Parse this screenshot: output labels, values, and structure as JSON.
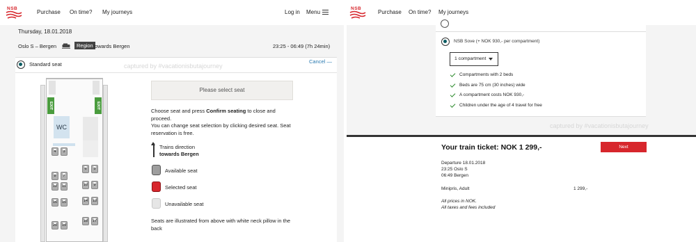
{
  "header": {
    "logo_text": "NSB",
    "nav": [
      "Purchase",
      "On time?",
      "My journeys"
    ],
    "login": "Log in",
    "menu": "Menu"
  },
  "journey": {
    "date": "Thursday, 18.01.2018",
    "route": "Oslo S – Bergen",
    "train_type": "Region",
    "towards": "towards Bergen",
    "time": "23:25 - 06:49 (7h 24min)"
  },
  "seating": {
    "option_label": "Standard seat",
    "cancel": "Cancel",
    "watermark": "captured by #vacationisbutajourney",
    "select_placeholder": "Please select seat",
    "instruction_1_pre": "Choose seat and press ",
    "instruction_1_bold": "Confirm seating",
    "instruction_1_post": " to close and proceed.",
    "instruction_2": "You can change seat selection by clicking desired seat. Seat reservation is free.",
    "direction_label": "Trains direction",
    "direction_value": "towards Bergen",
    "legend": [
      "Available seat",
      "Selected seat",
      "Unavailable seat"
    ],
    "note": "Seats are illustrated from above with white neck pillow in the back",
    "exit_label": "EXIT",
    "wc_label": "WC",
    "seats": [
      "4",
      "3",
      "8",
      "7",
      "6",
      "5",
      "12",
      "11",
      "10",
      "9",
      "16",
      "15",
      "14",
      "13",
      "20",
      "19",
      "18",
      "17"
    ]
  },
  "sleeper": {
    "option_label": "NSB Sove (+ NOK 930,- per compartment)",
    "dropdown_value": "1 compartment",
    "features": [
      "Compartments with 2 beds",
      "Beds are 75 cm (30 inches) wide",
      "A compartment costs NOK 930,-",
      "Children under the age of 4 travel for free"
    ],
    "watermark": "captured by #vacationisbutajourney"
  },
  "ticket": {
    "title": "Your train ticket: NOK 1 299,-",
    "next": "Next",
    "departure": "Departure 18.01.2018",
    "from": "23:25 Oslo S",
    "to": "06:49 Bergen",
    "fare": "Minipris, Adult",
    "fare_price": "1 299,-",
    "prices_note_1": "All prices in NOK.",
    "prices_note_2": "All taxes and fees included"
  },
  "colors": {
    "brand_red": "#d7272d",
    "next_red": "#d7262c",
    "exit_green": "#4a9c3e",
    "radio_teal": "#0b5c63",
    "link_blue": "#2a7ab0"
  }
}
